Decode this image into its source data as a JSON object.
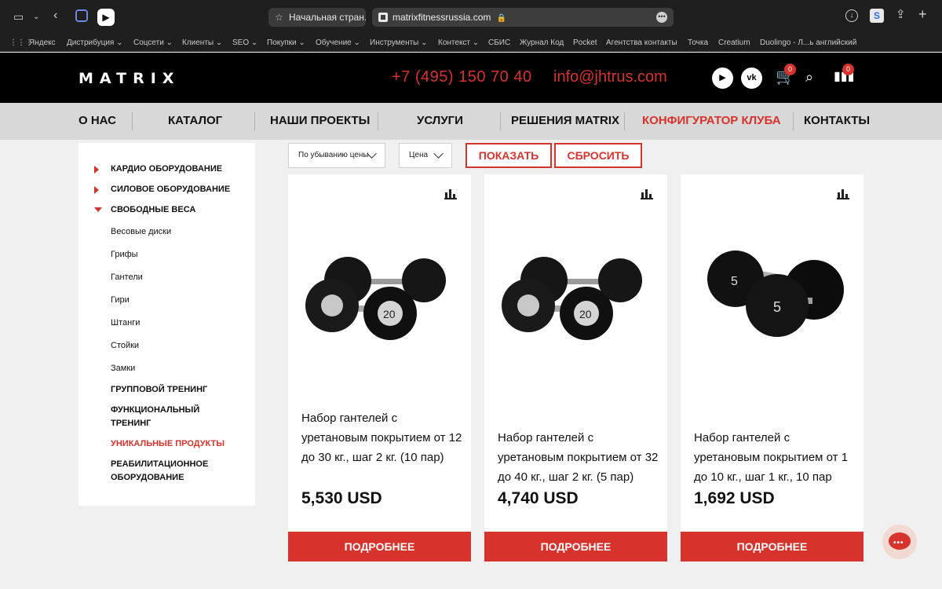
{
  "browser": {
    "tab_title": "Начальная стран...",
    "address": "matrixfitnessrussia.com",
    "bookmarks": [
      "Яндекс",
      "Дистрибуция ⌄",
      "Соцсети ⌄",
      "Клиенты ⌄",
      "SEO ⌄",
      "Покупки ⌄",
      "Обучение ⌄",
      "Инструменты ⌄",
      "Контекст ⌄",
      "СБИС",
      "Журнал Код",
      "Pocket",
      "Агентства контакты",
      "Точка",
      "Creatium",
      "Duolingo - Л...ь английский"
    ]
  },
  "header": {
    "logo": "MATRIX",
    "phone": "+7 (495) 150 70 40",
    "email": "info@jhtrus.com",
    "cart_count": "0",
    "compare_count": "0"
  },
  "nav": {
    "items": [
      "О НАС",
      "КАТАЛОГ",
      "НАШИ ПРОЕКТЫ",
      "УСЛУГИ",
      "РЕШЕНИЯ MATRIX",
      "КОНФИГУРАТОР КЛУБА",
      "КОНТАКТЫ"
    ],
    "active_index": 5
  },
  "sidebar": {
    "categories": [
      "КАРДИО ОБОРУДОВАНИЕ",
      "СИЛОВОЕ ОБОРУДОВАНИЕ",
      "СВОБОДНЫЕ ВЕСА",
      "ГРУППОВОЙ ТРЕНИНГ",
      "ФУНКЦИОНАЛЬНЫЙ ТРЕНИНГ",
      "УНИКАЛЬНЫЕ ПРОДУКТЫ",
      "РЕАБИЛИТАЦИОННОЕ ОБОРУДОВАНИЕ"
    ],
    "subitems": [
      "Весовые диски",
      "Грифы",
      "Гантели",
      "Гири",
      "Штанги",
      "Стойки",
      "Замки"
    ]
  },
  "filters": {
    "sort_value": "По убыванию цены",
    "price_value": "Цена",
    "show_label": "ПОКАЗАТЬ",
    "reset_label": "СБРОСИТЬ"
  },
  "products": [
    {
      "name": "Набор гантелей с уретановым покрытием от 12 до 30 кг., шаг 2 кг. (10 пар)",
      "price": "5,530 USD",
      "weight_label": "20",
      "button": "ПОДРОБНЕЕ"
    },
    {
      "name": "Набор гантелей с уретановым покрытием от 32 до 40 кг., шаг 2 кг. (5 пар)",
      "price": "4,740 USD",
      "weight_label": "20",
      "button": "ПОДРОБНЕЕ"
    },
    {
      "name": "Набор гантелей с уретановым покрытием от 1 до 10 кг., шаг 1 кг., 10 пар",
      "price": "1,692 USD",
      "weight_label": "5",
      "button": "ПОДРОБНЕЕ"
    }
  ],
  "colors": {
    "accent": "#d6332d",
    "header_bg": "#000000",
    "nav_bg": "#d8d8d8"
  }
}
